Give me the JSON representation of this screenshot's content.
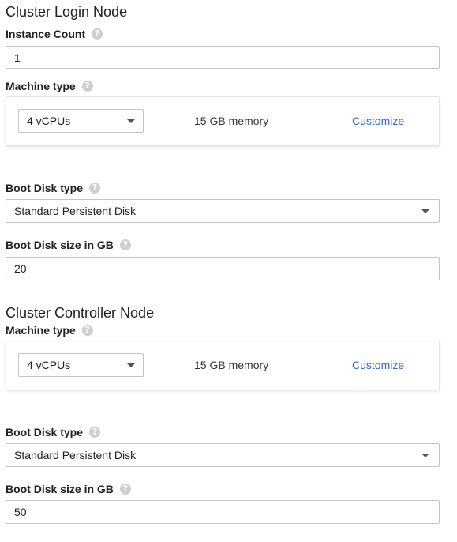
{
  "login": {
    "title": "Cluster Login Node",
    "instance_count": {
      "label": "Instance Count",
      "value": "1"
    },
    "machine": {
      "label": "Machine type",
      "cpu": "4 vCPUs",
      "memory": "15 GB memory",
      "customize": "Customize"
    },
    "boot_disk_type": {
      "label": "Boot Disk type",
      "value": "Standard Persistent Disk"
    },
    "boot_disk_size": {
      "label": "Boot Disk size in GB",
      "value": "20"
    }
  },
  "controller": {
    "title": "Cluster Controller Node",
    "machine": {
      "label": "Machine type",
      "cpu": "4 vCPUs",
      "memory": "15 GB memory",
      "customize": "Customize"
    },
    "boot_disk_type": {
      "label": "Boot Disk type",
      "value": "Standard Persistent Disk"
    },
    "boot_disk_size": {
      "label": "Boot Disk size in GB",
      "value": "50"
    }
  },
  "icons": {
    "help": "help-circle-icon",
    "dropdown": "caret-down-icon"
  },
  "colors": {
    "link": "#3367d6",
    "help_icon": "#cfcfcf",
    "border": "#c4c4c4"
  }
}
